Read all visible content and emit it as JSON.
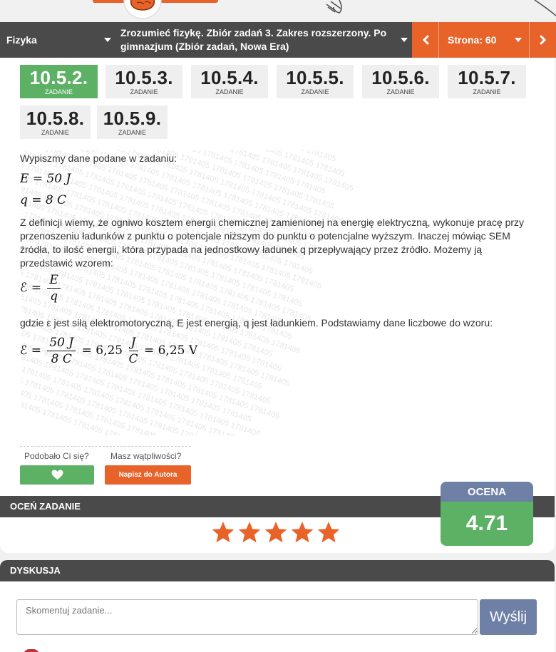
{
  "navbar": {
    "subject": "Fizyka",
    "book": "Zrozumieć fizykę. Zbiór zadań 3. Zakres rozszerzony. Po gimnazjum (Zbiór zadań, Nowa Era)",
    "prev_icon": "chevron-left-icon",
    "page_label": "Strona: 60",
    "next_icon": "chevron-right-icon"
  },
  "tasks": [
    {
      "num": "10.5.2.",
      "label": "ZADANIE",
      "active": true
    },
    {
      "num": "10.5.3.",
      "label": "ZADANIE",
      "active": false
    },
    {
      "num": "10.5.4.",
      "label": "ZADANIE",
      "active": false
    },
    {
      "num": "10.5.5.",
      "label": "ZADANIE",
      "active": false
    },
    {
      "num": "10.5.6.",
      "label": "ZADANIE",
      "active": false
    },
    {
      "num": "10.5.7.",
      "label": "ZADANIE",
      "active": false
    },
    {
      "num": "10.5.8.",
      "label": "ZADANIE",
      "active": false
    },
    {
      "num": "10.5.9.",
      "label": "ZADANIE",
      "active": false
    }
  ],
  "solution": {
    "intro": "Wypiszmy dane podane w zadaniu:",
    "eq1": "E = 50 J",
    "eq2": "q = 8 C",
    "para1": "Z definicji wiemy, że ogniwo kosztem energii chemicznej zamienionej na energię elektryczną, wykonuje pracę przy przenoszeniu ładunków z punktu o potencjale niższym do punktu o potencjalne wyższym. Inaczej mówiąc SEM źródła, to ilość energii, która przypada na jednostkowy ładunek q przepływający przez źródło. Możemy ją przedstawić wzorem:",
    "formula_lhs": "ℰ =",
    "formula_num": "E",
    "formula_den": "q",
    "para2": "gdzie ε jest siłą elektromotoryczną, E jest energią, q jest ładunkiem. Podstawiamy dane liczbowe do wzoru:",
    "calc_lhs": "ℰ =",
    "calc_num": "50 J",
    "calc_den": "8 C",
    "calc_mid": "= 6,25",
    "calc_unit_num": "J",
    "calc_unit_den": "C",
    "calc_result": "= 6,25 V",
    "watermark_text": "1781405"
  },
  "feedback": {
    "liked_question": "Podobało Ci się?",
    "doubt_question": "Masz wątpliwości?",
    "like_icon": "heart-icon",
    "author_button": "Napisz do Autora"
  },
  "rating": {
    "header": "OCEŃ ZADANIE",
    "stars": 5,
    "star_color": "#e8632a",
    "score_label": "OCENA",
    "score_value": "4.71"
  },
  "discussion": {
    "header": "DYSKUSJA",
    "placeholder": "Skomentuj zadanie...",
    "send_button": "Wyślij"
  },
  "colors": {
    "accent_orange": "#e8632a",
    "accent_green": "#5cb165",
    "bar_dark": "#4a4a4a",
    "slate_blue": "#6e80a5"
  }
}
